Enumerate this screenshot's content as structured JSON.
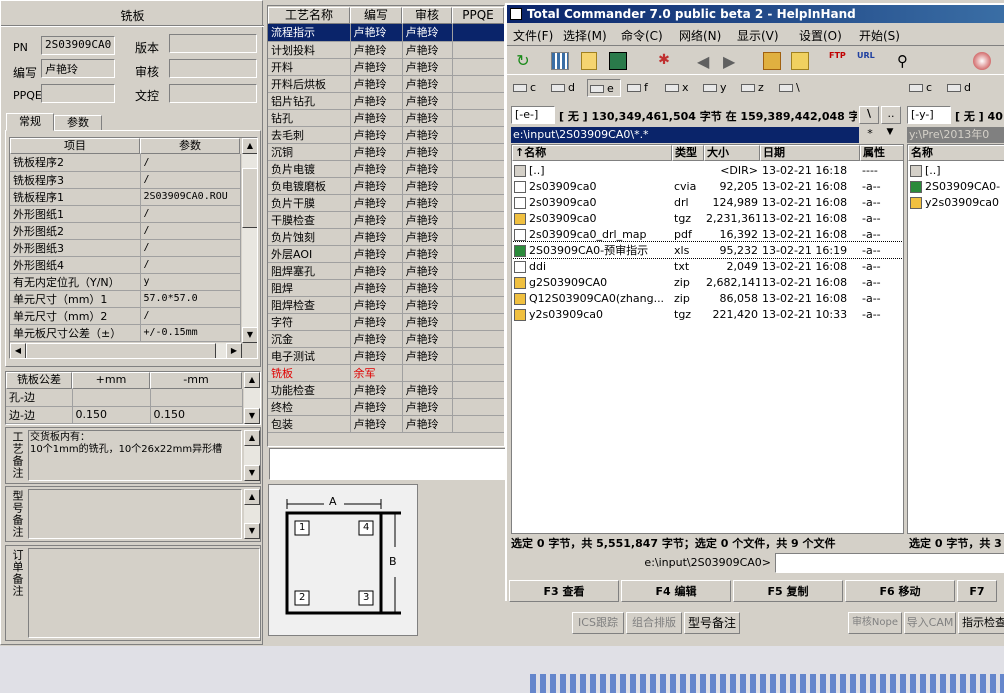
{
  "left": {
    "title": "铣板",
    "pn_label": "PN",
    "pn_value": "2S03909CA0",
    "version_label": "版本",
    "editor_label": "编写",
    "editor_value": "卢艳玲",
    "review_label": "审核",
    "ppqe_label": "PPQE",
    "doc_label": "文控",
    "tabs": [
      "常规",
      "参数"
    ],
    "param_headers": [
      "项目",
      "参数"
    ],
    "params": [
      [
        "铣板程序2",
        "/"
      ],
      [
        "铣板程序3",
        "/"
      ],
      [
        "铣板程序1",
        "2S03909CA0.ROU"
      ],
      [
        "外形图纸1",
        "/"
      ],
      [
        "外形图纸2",
        "/"
      ],
      [
        "外形图纸3",
        "/"
      ],
      [
        "外形图纸4",
        "/"
      ],
      [
        "有无内定位孔（Y/N）",
        "y"
      ],
      [
        "单元尺寸（mm）1",
        "57.0*57.0"
      ],
      [
        "单元尺寸（mm）2",
        "/"
      ],
      [
        "单元板尺寸公差（±）",
        "+/-0.15mm"
      ]
    ],
    "tol_headers": [
      "铣板公差",
      "+mm",
      "-mm"
    ],
    "tol_rows": [
      [
        "孔-边",
        "",
        ""
      ],
      [
        "边-边",
        "0.150",
        "0.150"
      ]
    ],
    "note_labels": [
      "工艺备注",
      "型号备注",
      "订单备注"
    ],
    "process_note": "交货板内有：\n10个1mm的铣孔，10个26x22mm异形槽"
  },
  "process": {
    "headers": [
      "工艺名称",
      "编写",
      "审核",
      "PPQE"
    ],
    "rows": [
      [
        "流程指示",
        "卢艳玲",
        "卢艳玲",
        ""
      ],
      [
        "计划投料",
        "卢艳玲",
        "卢艳玲",
        ""
      ],
      [
        "开料",
        "卢艳玲",
        "卢艳玲",
        ""
      ],
      [
        "开料后烘板",
        "卢艳玲",
        "卢艳玲",
        ""
      ],
      [
        "铝片钻孔",
        "卢艳玲",
        "卢艳玲",
        ""
      ],
      [
        "钻孔",
        "卢艳玲",
        "卢艳玲",
        ""
      ],
      [
        "去毛刺",
        "卢艳玲",
        "卢艳玲",
        ""
      ],
      [
        "沉铜",
        "卢艳玲",
        "卢艳玲",
        ""
      ],
      [
        "负片电镀",
        "卢艳玲",
        "卢艳玲",
        ""
      ],
      [
        "负电镀磨板",
        "卢艳玲",
        "卢艳玲",
        ""
      ],
      [
        "负片干膜",
        "卢艳玲",
        "卢艳玲",
        ""
      ],
      [
        "干膜检查",
        "卢艳玲",
        "卢艳玲",
        ""
      ],
      [
        "负片蚀刻",
        "卢艳玲",
        "卢艳玲",
        ""
      ],
      [
        "外层AOI",
        "卢艳玲",
        "卢艳玲",
        ""
      ],
      [
        "阻焊塞孔",
        "卢艳玲",
        "卢艳玲",
        ""
      ],
      [
        "阻焊",
        "卢艳玲",
        "卢艳玲",
        ""
      ],
      [
        "阻焊检查",
        "卢艳玲",
        "卢艳玲",
        ""
      ],
      [
        "字符",
        "卢艳玲",
        "卢艳玲",
        ""
      ],
      [
        "沉金",
        "卢艳玲",
        "卢艳玲",
        ""
      ],
      [
        "电子测试",
        "卢艳玲",
        "卢艳玲",
        ""
      ],
      [
        "铣板",
        "余军",
        "",
        ""
      ],
      [
        "功能检查",
        "卢艳玲",
        "卢艳玲",
        ""
      ],
      [
        "终检",
        "卢艳玲",
        "卢艳玲",
        ""
      ],
      [
        "包装",
        "卢艳玲",
        "卢艳玲",
        ""
      ]
    ]
  },
  "diagram": {
    "a": "A",
    "b": "B",
    "n1": "1",
    "n2": "2",
    "n3": "3",
    "n4": "4"
  },
  "tc": {
    "title": "Total Commander 7.0 public beta 2 - HelpInHand",
    "menu": [
      "文件(F)",
      "选择(M)",
      "命令(C)",
      "网络(N)",
      "显示(V)",
      "设置(O)",
      "开始(S)"
    ],
    "left_drives": [
      "c",
      "d",
      "e",
      "f",
      "x",
      "y",
      "z",
      "\\"
    ],
    "right_drives": [
      "c",
      "d"
    ],
    "left_drive_sel": "[-e-]",
    "left_free": "[ 无 ]  130,349,461,504 字节 在 159,389,442,048 字节",
    "right_drive_sel": "[-y-]",
    "right_free": "[ 无 ]  40",
    "left_path": "e:\\input\\2S03909CA0\\*.*",
    "right_path": "y:\\Pre\\2013年0",
    "cols": [
      "↑名称",
      "类型",
      "大小",
      "日期",
      "属性"
    ],
    "files": [
      [
        "[..]",
        "",
        "<DIR>",
        "13-02-21 16:18",
        "----"
      ],
      [
        "2s03909ca0",
        "cvia",
        "92,205",
        "13-02-21 16:08",
        "-a--"
      ],
      [
        "2s03909ca0",
        "drl",
        "124,989",
        "13-02-21 16:08",
        "-a--"
      ],
      [
        "2s03909ca0",
        "tgz",
        "2,231,361",
        "13-02-21 16:08",
        "-a--"
      ],
      [
        "2s03909ca0_drl_map",
        "pdf",
        "16,392",
        "13-02-21 16:08",
        "-a--"
      ],
      [
        "2S03909CA0-预审指示",
        "xls",
        "95,232",
        "13-02-21 16:19",
        "-a--"
      ],
      [
        "ddi",
        "txt",
        "2,049",
        "13-02-21 16:08",
        "-a--"
      ],
      [
        "g2S03909CA0",
        "zip",
        "2,682,141",
        "13-02-21 16:08",
        "-a--"
      ],
      [
        "Q12S03909CA0(zhang...",
        "zip",
        "86,058",
        "13-02-21 16:08",
        "-a--"
      ],
      [
        "y2s03909ca0",
        "tgz",
        "221,420",
        "13-02-21 10:33",
        "-a--"
      ]
    ],
    "right_col": "名称",
    "right_files": [
      "[..]",
      "2S03909CA0-",
      "y2s03909ca0"
    ],
    "left_status": "选定 0 字节，共 5,551,847 字节；选定 0 个文件，共 9 个文件",
    "right_status": "选定 0 字节，共 3",
    "cmd_path": "e:\\input\\2S03909CA0>",
    "fkeys": [
      "F3 查看",
      "F4 编辑",
      "F5 复制",
      "F6 移动",
      "F7"
    ]
  },
  "bottom": {
    "buttons": [
      "ICS跟踪",
      "组合排版",
      "型号备注",
      "审核Nope",
      "导入CAM",
      "指示检查"
    ]
  }
}
